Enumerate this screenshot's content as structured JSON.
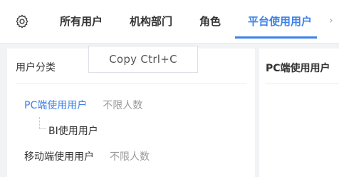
{
  "tabs": [
    {
      "label": "所有用户"
    },
    {
      "label": "机构部门"
    },
    {
      "label": "角色"
    },
    {
      "label": "平台使用用户"
    }
  ],
  "active_tab_index": 3,
  "tooltip": {
    "text": "Copy  Ctrl+C"
  },
  "left_panel": {
    "title": "用户分类",
    "items": [
      {
        "name": "PC端使用用户",
        "limit": "不限人数"
      },
      {
        "name": "BI使用用户"
      },
      {
        "name": "移动端使用用户",
        "limit": "不限人数"
      }
    ]
  },
  "right_panel": {
    "title": "PC端使用用户"
  },
  "colors": {
    "accent": "#3d82e8"
  }
}
